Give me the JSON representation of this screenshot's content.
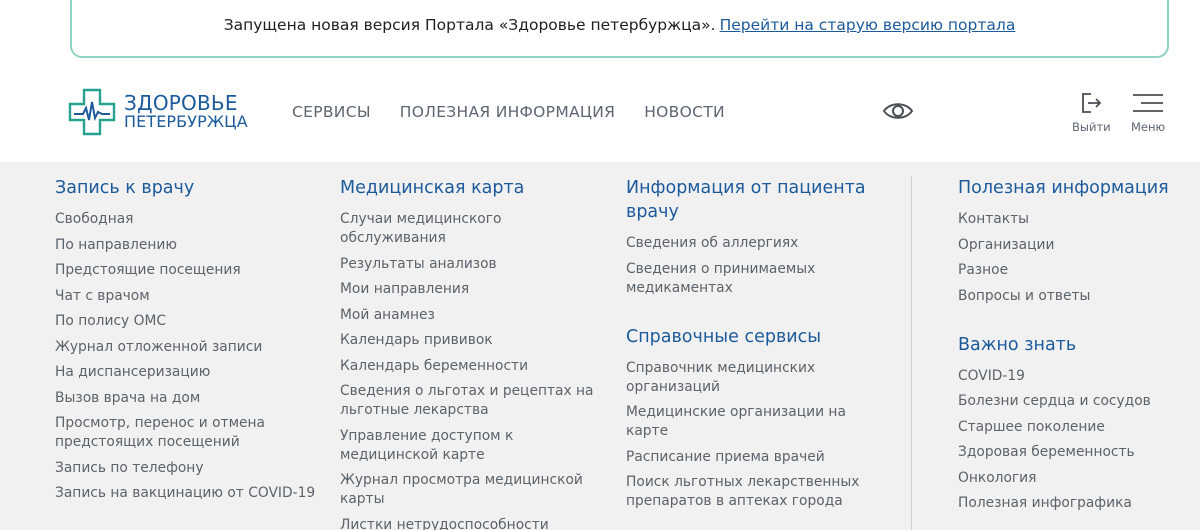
{
  "banner": {
    "text": "Запущена новая версия Портала «Здоровье петербуржца».",
    "link": "Перейти на старую версию портала"
  },
  "logo": {
    "line1": "ЗДОРОВЬЕ",
    "line2": "ПЕТЕРБУРЖЦА",
    "icon": "cross-pulse-icon"
  },
  "nav": {
    "items": [
      "СЕРВИСЫ",
      "ПОЛЕЗНАЯ ИНФОРМАЦИЯ",
      "НОВОСТИ"
    ]
  },
  "header": {
    "logout": "Выйти",
    "menu": "Меню",
    "accessibility_icon": "eye-icon"
  },
  "colors": {
    "accent": "#1c5a9c",
    "banner_border": "#8fd3c4",
    "panel_bg": "#f1f1f1",
    "link": "#5b636b"
  },
  "columns": {
    "c1": {
      "title": "Запись к врачу",
      "links": [
        "Свободная",
        "По направлению",
        "Предстоящие посещения",
        "Чат с врачом",
        "По полису ОМС",
        "Журнал отложенной записи",
        "На диспансеризацию",
        "Вызов врача на дом",
        "Просмотр, перенос и отмена предстоящих посещений",
        "Запись по телефону",
        "Запись на вакцинацию от COVID-19"
      ]
    },
    "c2": {
      "title": "Медицинская карта",
      "links": [
        "Случаи медицинского обслуживания",
        "Результаты анализов",
        "Мои направления",
        "Мой анамнез",
        "Календарь прививок",
        "Календарь беременности",
        "Сведения о льготах и рецептах на льготные лекарства",
        "Управление доступом к медицинской карте",
        "Журнал просмотра медицинской карты",
        "Листки нетрудоспособности"
      ]
    },
    "c3": {
      "title": "Информация от пациента врачу",
      "links": [
        "Сведения об аллергиях",
        "Сведения о принимаемых медикаментах"
      ],
      "title2": "Справочные сервисы",
      "links2": [
        "Справочник медицинских организаций",
        "Медицинские организации на карте",
        "Расписание приема врачей",
        "Поиск льготных лекарственных препаратов в аптеках города"
      ]
    },
    "c4": {
      "title": "Полезная информация",
      "links": [
        "Контакты",
        "Организации",
        "Разное",
        "Вопросы и ответы"
      ],
      "title2": "Важно знать",
      "links2": [
        "COVID-19",
        "Болезни сердца и сосудов",
        "Старшее поколение",
        "Здоровая беременность",
        "Онкология",
        "Полезная инфографика"
      ]
    }
  }
}
